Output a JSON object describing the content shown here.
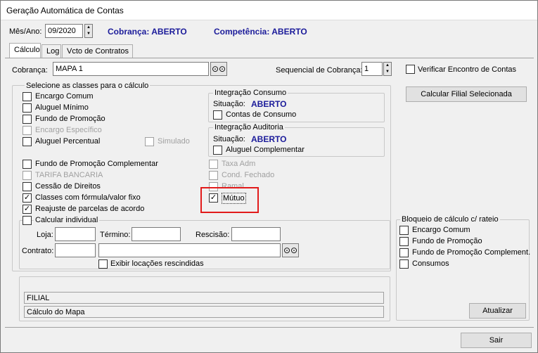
{
  "window": {
    "title": "Geração Automática de Contas"
  },
  "header": {
    "mes_ano_label": "Mês/Ano:",
    "mes_ano_value": "09/2020",
    "cobranca_status": "Cobrança: ABERTO",
    "competencia_status": "Competência: ABERTO"
  },
  "tabs": [
    {
      "label": "Cálculo"
    },
    {
      "label": "Log"
    },
    {
      "label": "Vcto de Contratos"
    }
  ],
  "cobranca": {
    "label": "Cobrança:",
    "value": "MAPA 1",
    "sequencial_label": "Sequencial de Cobrança:",
    "sequencial_value": "1",
    "verificar_label": "Verificar Encontro de Contas"
  },
  "classes": {
    "title": "Selecione as classes para o cálculo",
    "items": [
      {
        "label": "Encargo Comum",
        "checked": false,
        "enabled": true
      },
      {
        "label": "Aluguel Mínimo",
        "checked": false,
        "enabled": true
      },
      {
        "label": "Fundo de Promoção",
        "checked": false,
        "enabled": true
      },
      {
        "label": "Encargo Específico",
        "checked": false,
        "enabled": false
      },
      {
        "label": "Aluguel Percentual",
        "checked": false,
        "enabled": true
      },
      {
        "label": "Simulado",
        "checked": false,
        "enabled": false
      },
      {
        "label": "Fundo de Promoção Complementar",
        "checked": false,
        "enabled": true
      },
      {
        "label": "TARIFA BANCARIA",
        "checked": false,
        "enabled": false
      },
      {
        "label": "Cessão de Direitos",
        "checked": false,
        "enabled": true
      },
      {
        "label": "Classes com fórmula/valor fixo",
        "checked": true,
        "enabled": true
      },
      {
        "label": "Reajuste de parcelas de acordo",
        "checked": true,
        "enabled": true
      },
      {
        "label": "Taxa Adm",
        "checked": false,
        "enabled": false
      },
      {
        "label": "Cond. Fechado",
        "checked": false,
        "enabled": false
      },
      {
        "label": "Ramal",
        "checked": false,
        "enabled": false
      },
      {
        "label": "Mútuo",
        "checked": true,
        "enabled": true
      }
    ]
  },
  "integracao_consumo": {
    "title": "Integração Consumo",
    "situacao_label": "Situação:",
    "situacao_value": "ABERTO",
    "checkbox_label": "Contas de Consumo"
  },
  "integracao_auditoria": {
    "title": "Integração Auditoria",
    "situacao_label": "Situação:",
    "situacao_value": "ABERTO",
    "checkbox_label": "Aluguel Complementar"
  },
  "calcular_individual": {
    "label": "Calcular individual",
    "loja_label": "Loja:",
    "termino_label": "Término:",
    "rescisao_label": "Rescisão:",
    "contrato_label": "Contrato:",
    "exibir_label": "Exibir locações rescindidas"
  },
  "status_fields": {
    "filial": "FILIAL",
    "calculo": "Cálculo do Mapa"
  },
  "buttons": {
    "calcular_filial": "Calcular Filial Selecionada",
    "atualizar": "Atualizar",
    "sair": "Sair"
  },
  "bloqueio": {
    "title": "Bloqueio de cálculo c/ rateio",
    "items": [
      {
        "label": "Encargo Comum"
      },
      {
        "label": "Fundo de Promoção"
      },
      {
        "label": "Fundo de Promoção Complement."
      },
      {
        "label": "Consumos"
      }
    ]
  },
  "colors": {
    "status_blue": "#1b1b9a",
    "highlight_red": "#e21b1b"
  }
}
